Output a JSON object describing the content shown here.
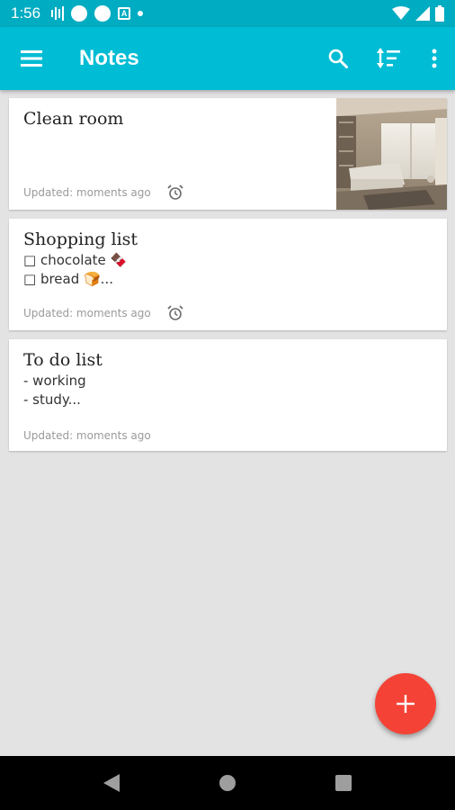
{
  "status_bar": {
    "time": "1:56"
  },
  "app_bar": {
    "title": "Notes"
  },
  "notes": [
    {
      "title": "Clean room",
      "text": "",
      "updated": "Updated: moments ago",
      "has_alarm": true,
      "has_image": true
    },
    {
      "title": "Shopping list",
      "text": "□ chocolate 🍫\n□ bread 🍞...",
      "updated": "Updated: moments ago",
      "has_alarm": true,
      "has_image": false
    },
    {
      "title": "To do list",
      "text": "- working\n- study...",
      "updated": "Updated: moments ago",
      "has_alarm": false,
      "has_image": false
    }
  ],
  "colors": {
    "primary": "#00bcd4",
    "status": "#00acc1",
    "fab": "#f44336",
    "background": "#e3e3e3"
  },
  "icons": {
    "menu": "hamburger-icon",
    "search": "search-icon",
    "sort": "sort-icon",
    "more": "more-vert-icon",
    "alarm": "alarm-icon",
    "add": "plus-icon"
  }
}
